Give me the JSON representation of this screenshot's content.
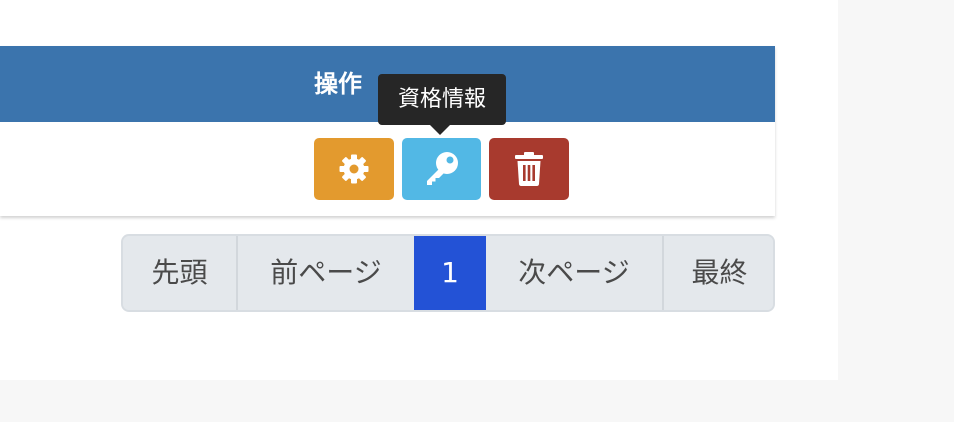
{
  "table": {
    "header_label": "操作"
  },
  "row_actions": {
    "settings_icon": "gear-icon",
    "key_icon": "key-icon",
    "delete_icon": "trash-icon",
    "colors": {
      "settings": "#e39a2e",
      "key": "#52b8e5",
      "delete": "#a83a2e"
    }
  },
  "tooltip": {
    "text": "資格情報"
  },
  "pagination": {
    "first": "先頭",
    "prev": "前ページ",
    "current": "1",
    "next": "次ページ",
    "last": "最終",
    "active_color": "#2352d6"
  },
  "header_color": "#3b74ad"
}
